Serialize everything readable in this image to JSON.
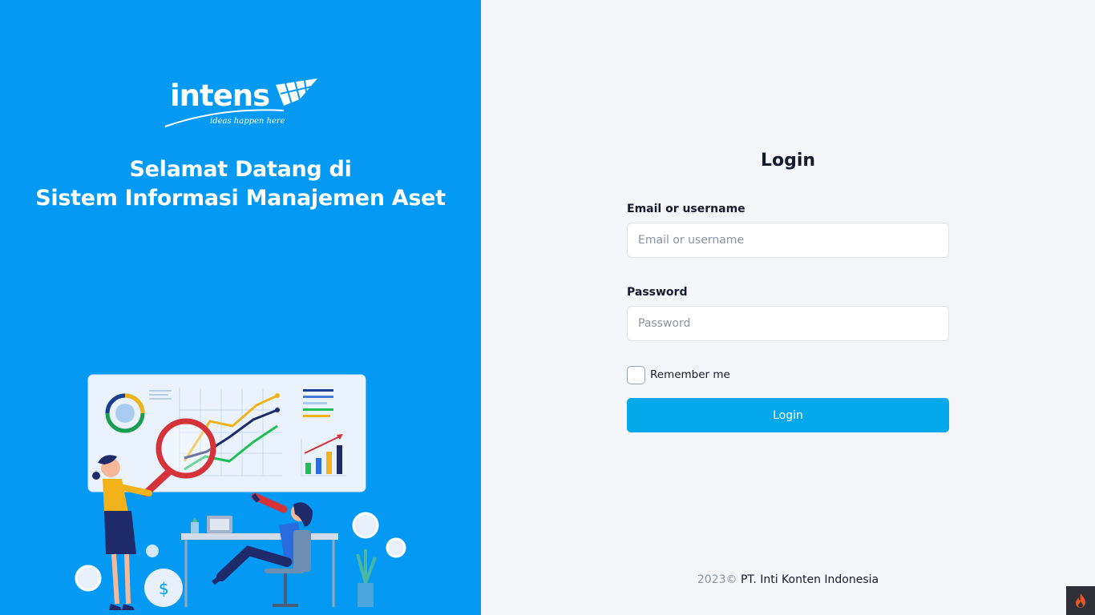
{
  "brand": {
    "logo_text": "intens",
    "tagline": "ideas happen here"
  },
  "welcome": {
    "line1": "Selamat Datang di",
    "line2": "Sistem Informasi Manajemen Aset"
  },
  "login": {
    "title": "Login",
    "email_label": "Email or username",
    "email_placeholder": "Email or username",
    "password_label": "Password",
    "password_placeholder": "Password",
    "remember_label": "Remember me",
    "submit_label": "Login"
  },
  "footer": {
    "year": "2023©",
    "company": "PT. Inti Konten Indonesia"
  },
  "colors": {
    "left_panel": "#0499f2",
    "button": "#06a8ec",
    "background": "#f4f6f9"
  },
  "icons": {
    "corner": "flame-icon"
  }
}
